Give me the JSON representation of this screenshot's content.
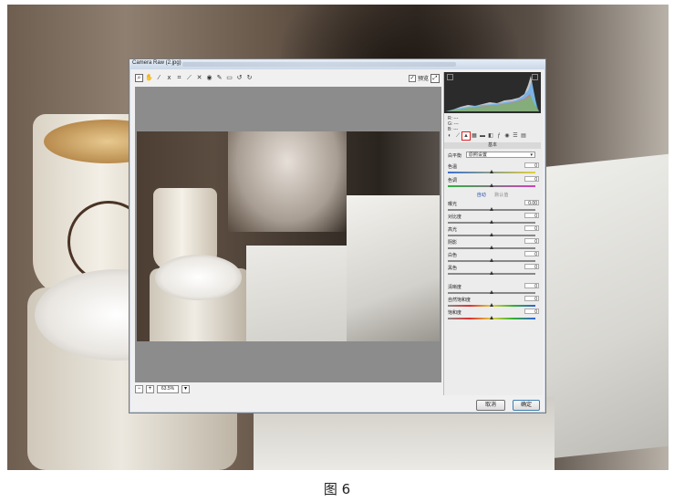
{
  "figure_caption": "图 6",
  "dialog": {
    "title": "Camera Raw (2.jpg)",
    "preview_label": "预览",
    "zoom_value": "63.5%",
    "cancel_label": "取消",
    "ok_label": "确定",
    "toolbar_icons": [
      "zoom-icon",
      "hand-icon",
      "white-balance-icon",
      "color-sampler-icon",
      "crop-icon",
      "straighten-icon",
      "spot-removal-icon",
      "red-eye-icon",
      "adjustment-brush-icon",
      "graduated-filter-icon",
      "rotate-ccw-icon",
      "rotate-cw-icon"
    ]
  },
  "panel": {
    "rgb_labels": [
      "R: ---",
      "G: ---",
      "B: ---"
    ],
    "section_title": "基本",
    "white_balance_label": "白平衡",
    "white_balance_value": "原照设置",
    "temperature_label": "色温",
    "temperature_value": "0",
    "tint_label": "色调",
    "tint_value": "0",
    "auto_label": "自动",
    "default_label": "默认值",
    "exposure_label": "曝光",
    "exposure_value": "0.00",
    "contrast_label": "对比度",
    "contrast_value": "0",
    "highlights_label": "高光",
    "highlights_value": "0",
    "shadows_label": "阴影",
    "shadows_value": "0",
    "whites_label": "白色",
    "whites_value": "0",
    "blacks_label": "黑色",
    "blacks_value": "0",
    "clarity_label": "清晰度",
    "clarity_value": "0",
    "vibrance_label": "自然饱和度",
    "vibrance_value": "0",
    "saturation_label": "饱和度",
    "saturation_value": "0",
    "tab_icons": [
      "basic-tab-icon",
      "tone-curve-icon",
      "detail-tab-icon",
      "hsl-tab-icon",
      "split-toning-icon",
      "lens-corrections-icon",
      "effects-tab-icon",
      "camera-calibration-icon",
      "presets-tab-icon",
      "snapshots-tab-icon"
    ],
    "active_tab_highlight_color": "#e02020"
  }
}
